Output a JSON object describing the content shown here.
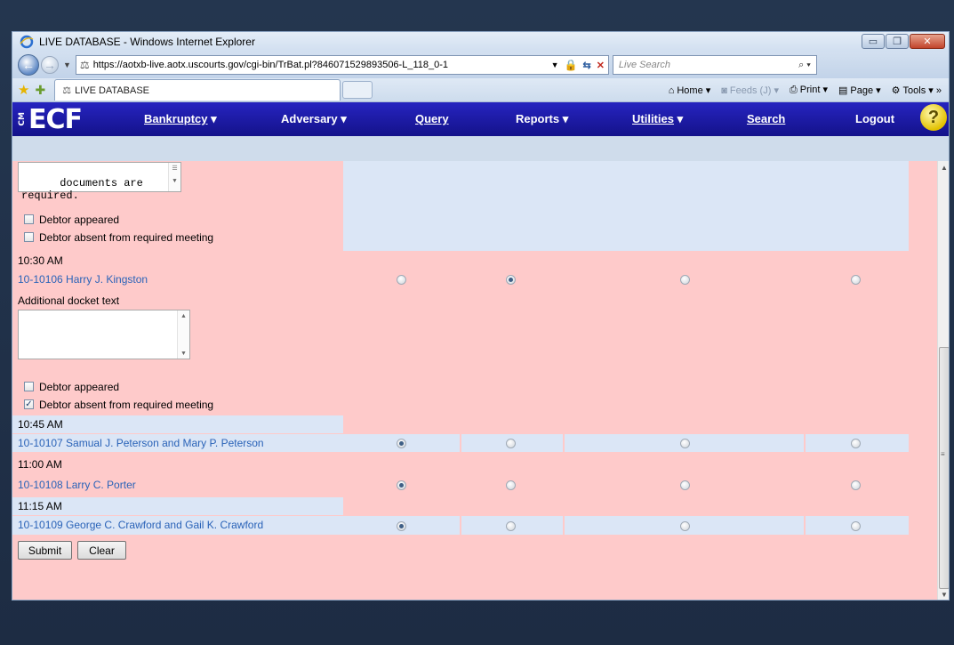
{
  "window": {
    "title": "LIVE DATABASE - Windows Internet Explorer",
    "controls": [
      "minimize",
      "maximize",
      "close"
    ]
  },
  "address": {
    "url": "https://aotxb-live.aotx.uscourts.gov/cgi-bin/TrBat.pl?846071529893506-L_118_0-1",
    "search_placeholder": "Live Search"
  },
  "tab": {
    "label": "LIVE DATABASE"
  },
  "commands": {
    "home": "Home",
    "feeds": "Feeds (J)",
    "print": "Print",
    "page": "Page",
    "tools": "Tools"
  },
  "ecf": {
    "logo": "ECF",
    "logo_prefix": "CM",
    "menu": [
      {
        "label": "Bankruptcy",
        "dropdown": true
      },
      {
        "label": "Adversary",
        "dropdown": true
      },
      {
        "label": "Query",
        "dropdown": false
      },
      {
        "label": "Reports",
        "dropdown": true
      },
      {
        "label": "Utilities",
        "dropdown": true
      },
      {
        "label": "Search",
        "dropdown": false
      },
      {
        "label": "Logout",
        "dropdown": false
      }
    ],
    "help": "?"
  },
  "form": {
    "top_textarea": "documents are\nrequired.",
    "debtor_appeared_label": "Debtor appeared",
    "debtor_absent_label": "Debtor absent from required meeting",
    "additional_docket_label": "Additional docket text",
    "cases": [
      {
        "time": "10:30 AM",
        "case": "10-10106 Harry J. Kingston",
        "selected": 2
      },
      {
        "time": "10:45 AM",
        "case": "10-10107 Samual J. Peterson and Mary P. Peterson",
        "selected": 1
      },
      {
        "time": "11:00 AM",
        "case": "10-10108 Larry C. Porter",
        "selected": 1
      },
      {
        "time": "11:15 AM",
        "case": "10-10109 George C. Crawford and Gail K. Crawford",
        "selected": 1
      }
    ],
    "checkboxes": {
      "block1_appeared": false,
      "block1_absent": false,
      "block2_appeared": false,
      "block2_absent": true
    },
    "submit_label": "Submit",
    "clear_label": "Clear"
  }
}
